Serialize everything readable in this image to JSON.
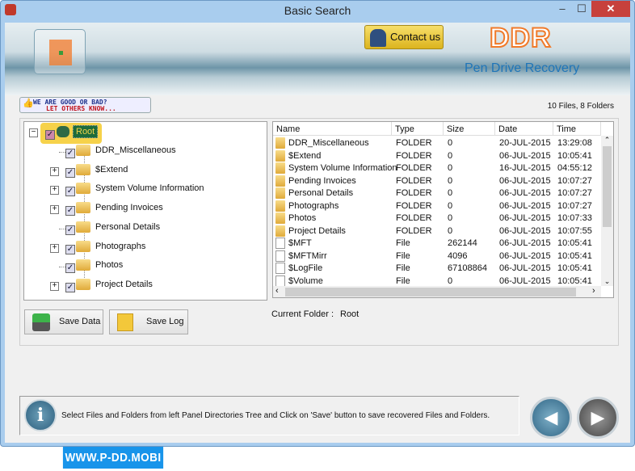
{
  "window": {
    "title": "Basic Search",
    "minimize": "‒",
    "maximize": "☐",
    "close": "✕"
  },
  "header": {
    "contact_label": "Contact us",
    "brand": "DDR",
    "product": "Pen Drive Recovery"
  },
  "rate": {
    "line1": "WE ARE GOOD OR BAD?",
    "line2": "LET OTHERS KNOW..."
  },
  "counts": "10 Files, 8 Folders",
  "tree": {
    "root": "Root",
    "items": [
      {
        "label": "DDR_Miscellaneous",
        "expandable": false
      },
      {
        "label": "$Extend",
        "expandable": true
      },
      {
        "label": "System Volume Information",
        "expandable": true
      },
      {
        "label": "Pending Invoices",
        "expandable": true
      },
      {
        "label": "Personal Details",
        "expandable": false
      },
      {
        "label": "Photographs",
        "expandable": true
      },
      {
        "label": "Photos",
        "expandable": false
      },
      {
        "label": "Project Details",
        "expandable": true
      }
    ]
  },
  "list": {
    "columns": [
      "Name",
      "Type",
      "Size",
      "Date",
      "Time"
    ],
    "rows": [
      [
        "DDR_Miscellaneous",
        "FOLDER",
        "0",
        "20-JUL-2015",
        "13:29:08"
      ],
      [
        "$Extend",
        "FOLDER",
        "0",
        "06-JUL-2015",
        "10:05:41"
      ],
      [
        "System Volume Information",
        "FOLDER",
        "0",
        "16-JUL-2015",
        "04:55:12"
      ],
      [
        "Pending Invoices",
        "FOLDER",
        "0",
        "06-JUL-2015",
        "10:07:27"
      ],
      [
        "Personal Details",
        "FOLDER",
        "0",
        "06-JUL-2015",
        "10:07:27"
      ],
      [
        "Photographs",
        "FOLDER",
        "0",
        "06-JUL-2015",
        "10:07:27"
      ],
      [
        "Photos",
        "FOLDER",
        "0",
        "06-JUL-2015",
        "10:07:33"
      ],
      [
        "Project Details",
        "FOLDER",
        "0",
        "06-JUL-2015",
        "10:07:55"
      ],
      [
        "$MFT",
        "File",
        "262144",
        "06-JUL-2015",
        "10:05:41"
      ],
      [
        "$MFTMirr",
        "File",
        "4096",
        "06-JUL-2015",
        "10:05:41"
      ],
      [
        "$LogFile",
        "File",
        "67108864",
        "06-JUL-2015",
        "10:05:41"
      ],
      [
        "$Volume",
        "File",
        "0",
        "06-JUL-2015",
        "10:05:41"
      ]
    ]
  },
  "buttons": {
    "save_data": "Save Data",
    "save_log": "Save Log",
    "back": "◀",
    "next": "▶"
  },
  "current_folder": {
    "label": "Current Folder :",
    "value": "Root"
  },
  "info": {
    "icon": "i",
    "text": "Select Files and Folders from left Panel Directories Tree and Click on 'Save' button to save recovered Files and Folders."
  },
  "watermark": "WWW.P-DD.MOBI"
}
